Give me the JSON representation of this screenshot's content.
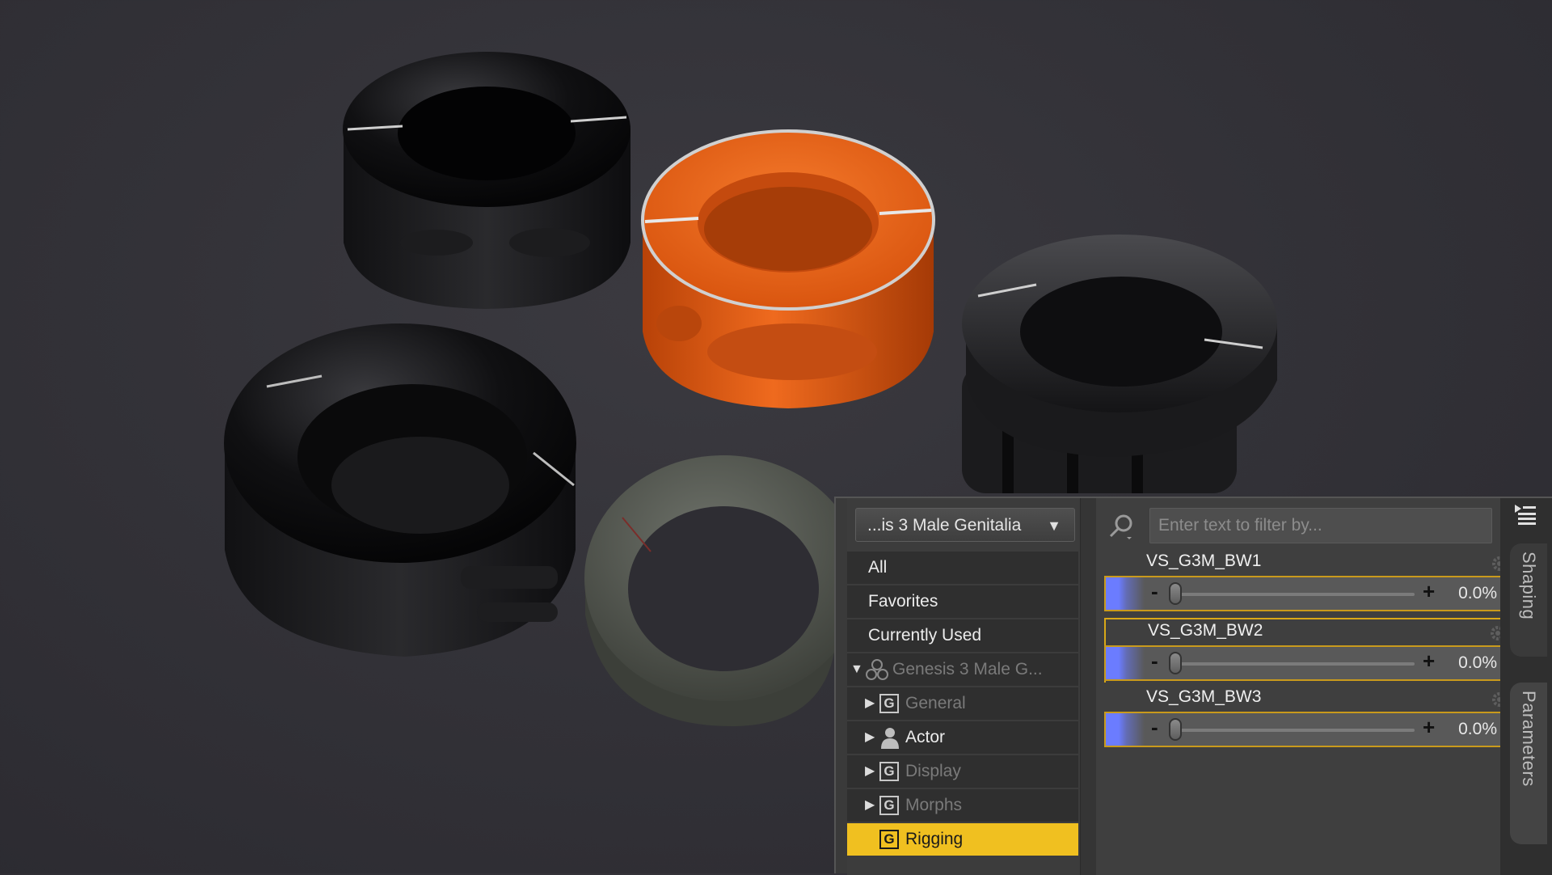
{
  "scene": {
    "product_colors": [
      "#0b0b0c",
      "#e35a14",
      "#1a1a1c",
      "#5a5e56",
      "#1e1e20"
    ]
  },
  "panel": {
    "preset_select": "...is 3 Male Genitalia",
    "tree": {
      "all": "All",
      "favorites": "Favorites",
      "currently_used": "Currently Used",
      "root": "Genesis 3 Male G...",
      "general": "General",
      "actor": "Actor",
      "display": "Display",
      "morphs": "Morphs",
      "rigging": "Rigging"
    },
    "search": {
      "placeholder": "Enter text to filter by..."
    },
    "params": [
      {
        "name": "VS_G3M_BW1",
        "value": "0.0%",
        "fraction": 0.0
      },
      {
        "name": "VS_G3M_BW2",
        "value": "0.0%",
        "fraction": 0.0
      },
      {
        "name": "VS_G3M_BW3",
        "value": "0.0%",
        "fraction": 0.0
      }
    ],
    "side_tabs": {
      "shaping": "Shaping",
      "parameters": "Parameters"
    },
    "accent": "#f0c020",
    "slider_color": "#6b7cff"
  }
}
